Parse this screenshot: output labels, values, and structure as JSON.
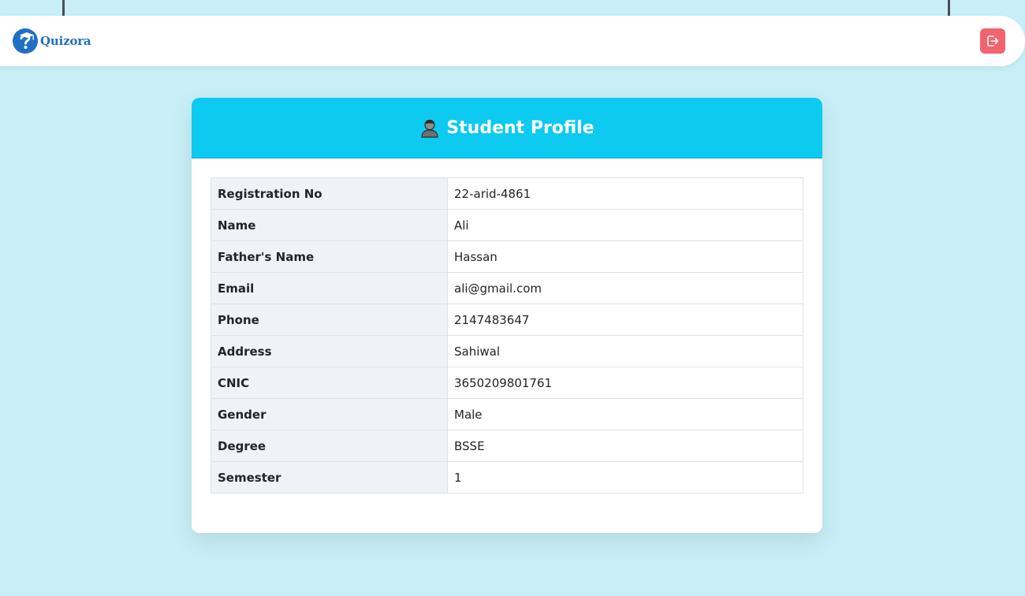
{
  "brand": {
    "name": "Quizora",
    "logo_icon": "graduation-question-logo"
  },
  "navbar": {
    "logout_icon": "logout-icon",
    "logout_color": "#f26370"
  },
  "profile": {
    "title": "Student Profile",
    "header_icon": "student-person-icon",
    "header_color": "#0dcaf0",
    "rows": [
      {
        "label": "Registration No",
        "value": "22-arid-4861"
      },
      {
        "label": "Name",
        "value": "Ali"
      },
      {
        "label": "Father's Name",
        "value": "Hassan"
      },
      {
        "label": "Email",
        "value": "ali@gmail.com"
      },
      {
        "label": "Phone",
        "value": "2147483647"
      },
      {
        "label": "Address",
        "value": "Sahiwal"
      },
      {
        "label": "CNIC",
        "value": "3650209801761"
      },
      {
        "label": "Gender",
        "value": "Male"
      },
      {
        "label": "Degree",
        "value": "BSSE"
      },
      {
        "label": "Semester",
        "value": "1"
      }
    ]
  }
}
